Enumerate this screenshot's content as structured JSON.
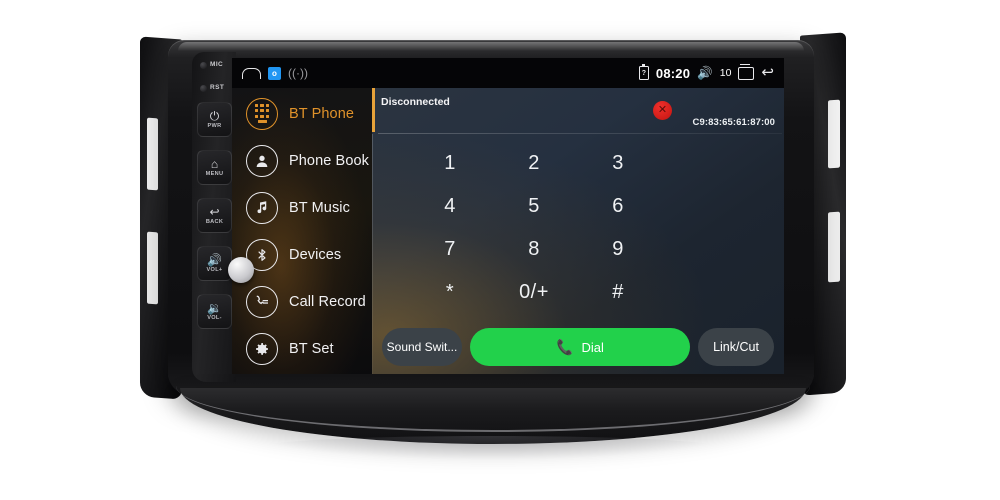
{
  "device": {
    "name": "car-head-unit",
    "bezel_buttons": [
      {
        "id": "mic",
        "label": "MIC",
        "type": "led"
      },
      {
        "id": "rst",
        "label": "RST",
        "type": "led"
      },
      {
        "id": "pwr",
        "label": "PWR",
        "glyph": "⏻"
      },
      {
        "id": "menu",
        "label": "MENU",
        "glyph": "⌂"
      },
      {
        "id": "back",
        "label": "BACK",
        "glyph": "↩"
      },
      {
        "id": "volup",
        "label": "VOL+",
        "glyph": "🔊"
      },
      {
        "id": "voldn",
        "label": "VOL-",
        "glyph": "🔉"
      }
    ]
  },
  "statusbar": {
    "home_icon": "home-icon",
    "app_icon_label": "o",
    "wifi_icon": "((·))",
    "battery_icon": "battery-icon",
    "battery_glyph": "?",
    "time": "08:20",
    "speaker_icon": "🔊",
    "volume": "10",
    "recents_icon": "recent-apps-icon",
    "back_icon": "↩"
  },
  "sidebar": {
    "items": [
      {
        "label": "BT Phone",
        "icon": "dialpad-icon",
        "active": true
      },
      {
        "label": "Phone Book",
        "icon": "contact-icon",
        "active": false
      },
      {
        "label": "BT Music",
        "icon": "music-note-icon",
        "active": false
      },
      {
        "label": "Devices",
        "icon": "bluetooth-icon",
        "active": false
      },
      {
        "label": "Call Record",
        "icon": "call-log-icon",
        "active": false
      },
      {
        "label": "BT Set",
        "icon": "gear-icon",
        "active": false
      }
    ]
  },
  "panel": {
    "connection_status": "Disconnected",
    "disconnect_label": "✕",
    "mac_address": "C9:83:65:61:87:00",
    "keypad": [
      "1",
      "2",
      "3",
      "4",
      "5",
      "6",
      "7",
      "8",
      "9",
      "*",
      "0/+",
      "#"
    ],
    "actions": {
      "sound_switch": "Sound Swit...",
      "dial": "Dial",
      "dial_icon": "📞",
      "link_cut": "Link/Cut"
    }
  },
  "colors": {
    "accent_orange": "#e0922a",
    "dial_green": "#22d14b",
    "disconnect_red": "#e02a26",
    "panel_blue": "#253040"
  }
}
